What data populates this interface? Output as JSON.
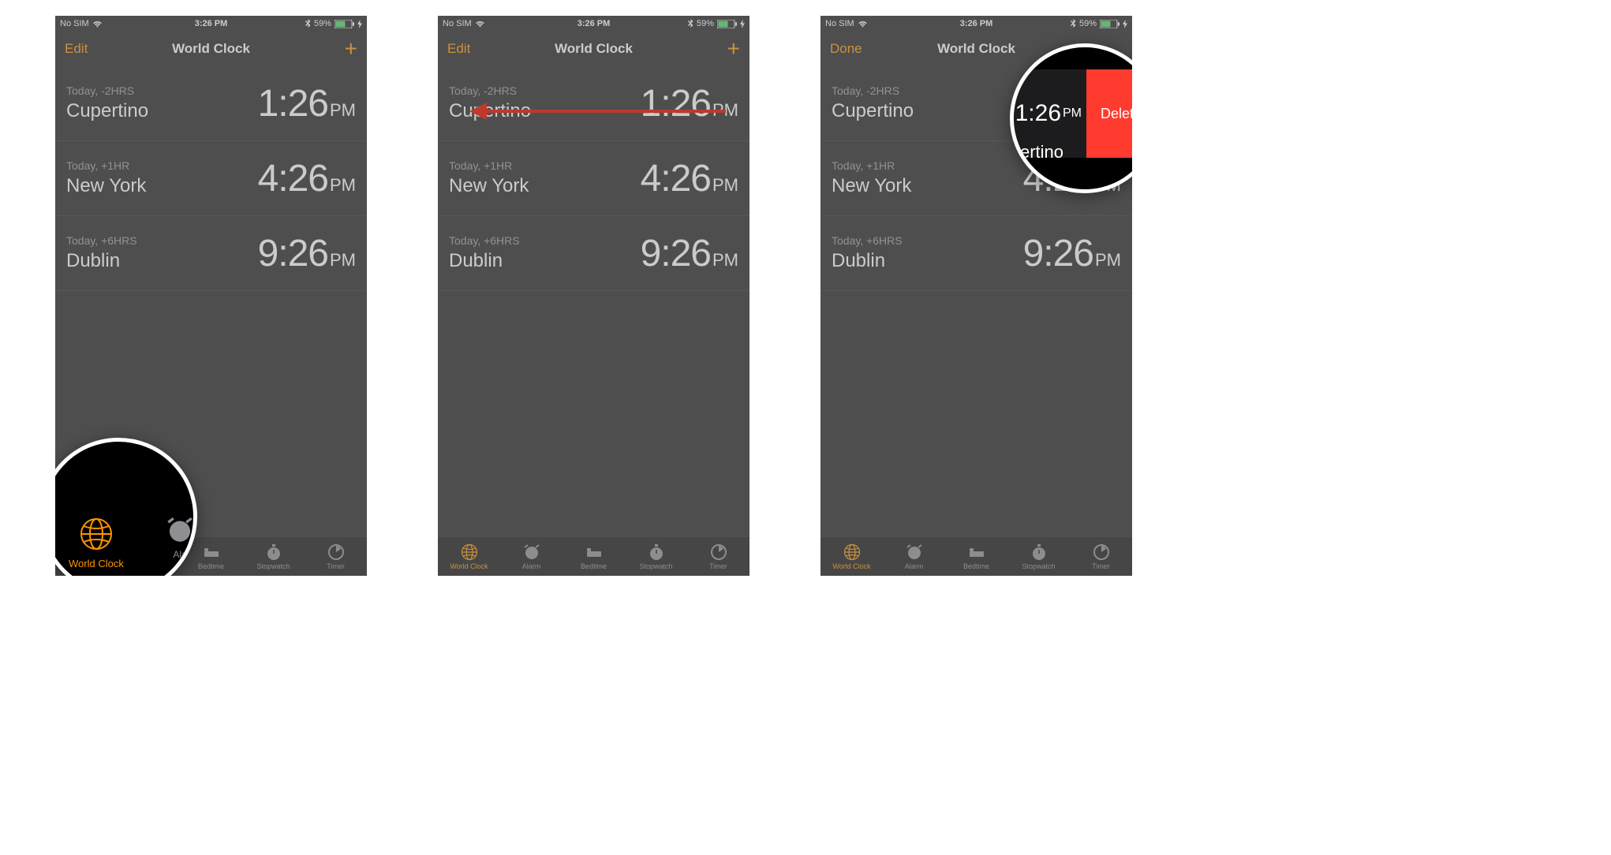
{
  "status": {
    "carrier": "No SIM",
    "time": "3:26 PM",
    "battery": "59%"
  },
  "nav": {
    "edit": "Edit",
    "done": "Done",
    "title": "World Clock",
    "add": "+"
  },
  "clocks": [
    {
      "offset": "Today, -2HRS",
      "city": "Cupertino",
      "hm": "1:26",
      "ampm": "PM"
    },
    {
      "offset": "Today, +1HR",
      "city": "New York",
      "hm": "4:26",
      "ampm": "PM"
    },
    {
      "offset": "Today, +6HRS",
      "city": "Dublin",
      "hm": "9:26",
      "ampm": "PM"
    }
  ],
  "tabs": [
    {
      "label": "World Clock"
    },
    {
      "label": "Alarm"
    },
    {
      "label": "Bedtime"
    },
    {
      "label": "Stopwatch"
    },
    {
      "label": "Timer"
    }
  ],
  "magnifier": {
    "worldclock": "World Clock",
    "alarm_partial": "Ala",
    "delete": "Delete",
    "ertino": "ertino",
    "hm": "1:26",
    "ampm": "PM"
  }
}
